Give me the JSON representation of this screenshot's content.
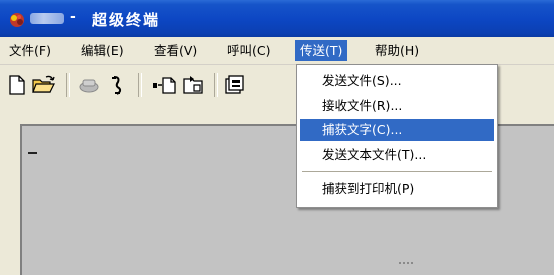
{
  "window": {
    "title": "超级终端",
    "title_separator": "-",
    "icon": "phone-icon"
  },
  "menubar": {
    "items": [
      {
        "label": "文件(F)"
      },
      {
        "label": "编辑(E)"
      },
      {
        "label": "查看(V)"
      },
      {
        "label": "呼叫(C)"
      },
      {
        "label": "传送(T)",
        "active": true
      },
      {
        "label": "帮助(H)"
      }
    ]
  },
  "toolbar": {
    "buttons": [
      {
        "icon": "new-document-icon"
      },
      {
        "icon": "open-folder-icon"
      },
      {
        "icon": "call-icon"
      },
      {
        "icon": "disconnect-icon"
      },
      {
        "icon": "send-icon"
      },
      {
        "icon": "receive-icon"
      },
      {
        "icon": "properties-icon"
      }
    ]
  },
  "transfer_menu": {
    "items": [
      {
        "label": "发送文件(S)..."
      },
      {
        "label": "接收文件(R)..."
      },
      {
        "label": "捕获文字(C)...",
        "highlighted": true
      },
      {
        "label": "发送文本文件(T)..."
      },
      {
        "label": "捕获到打印机(P)"
      }
    ]
  },
  "colors": {
    "title_bar": "#0d47c4",
    "menu_highlight": "#316ac5",
    "terminal_bg": "#c3c3c3",
    "chrome_bg": "#ece9d8"
  }
}
